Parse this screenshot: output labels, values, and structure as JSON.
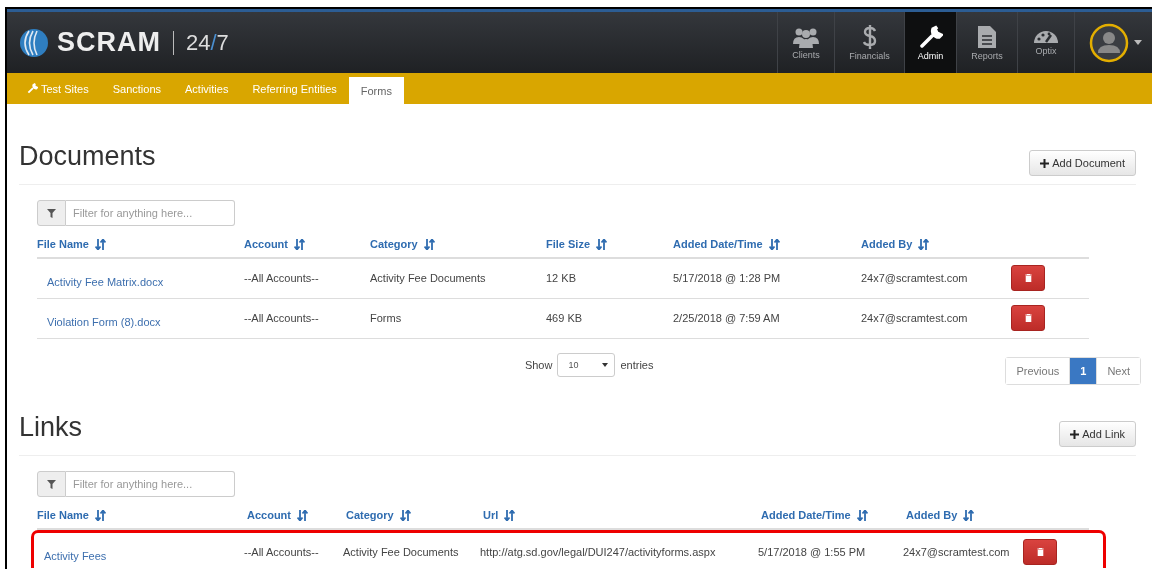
{
  "header": {
    "logo_text": "SCRAM",
    "product": [
      "24",
      "/",
      "7"
    ],
    "nav_items": [
      {
        "label": "Clients",
        "selected": false
      },
      {
        "label": "Financials",
        "selected": false
      },
      {
        "label": "Admin",
        "selected": true
      },
      {
        "label": "Reports",
        "selected": false
      },
      {
        "label": "Optix",
        "selected": false
      }
    ]
  },
  "subnav": [
    {
      "label": "Test Sites",
      "selected": false
    },
    {
      "label": "Sanctions",
      "selected": false
    },
    {
      "label": "Activities",
      "selected": false
    },
    {
      "label": "Referring Entities",
      "selected": false
    },
    {
      "label": "Forms",
      "selected": true
    }
  ],
  "documents": {
    "title": "Documents",
    "add_button": "Add Document",
    "filter_placeholder": "Filter for anything here...",
    "columns": [
      "File Name",
      "Account",
      "Category",
      "File Size",
      "Added Date/Time",
      "Added By"
    ],
    "rows": [
      {
        "highlighted": false,
        "cells": [
          "Activity Fee Matrix.docx",
          "--All Accounts--",
          "Activity Fee Documents",
          "12 KB",
          "5/17/2018 @ 1:28 PM",
          "24x7@scramtest.com"
        ]
      },
      {
        "highlighted": false,
        "cells": [
          "Violation Form (8).docx",
          "--All Accounts--",
          "Forms",
          "469 KB",
          "2/25/2018 @ 7:59 AM",
          "24x7@scramtest.com"
        ]
      }
    ],
    "show_label": "Show",
    "page_size": "10",
    "entries_label": "entries",
    "pagination": {
      "previous": "Previous",
      "pages": [
        {
          "label": "1",
          "selected": true
        }
      ],
      "next": "Next"
    }
  },
  "links": {
    "title": "Links",
    "add_button": "Add Link",
    "filter_placeholder": "Filter for anything here...",
    "columns": [
      "File Name",
      "Account",
      "Category",
      "Url",
      "Added Date/Time",
      "Added By"
    ],
    "rows": [
      {
        "highlighted": true,
        "cells": [
          "Activity Fees",
          "--All Accounts--",
          "Activity Fee Documents",
          "http://atg.sd.gov/legal/DUI247/activityforms.aspx",
          "5/17/2018 @ 1:55 PM",
          "24x7@scramtest.com"
        ]
      }
    ]
  }
}
